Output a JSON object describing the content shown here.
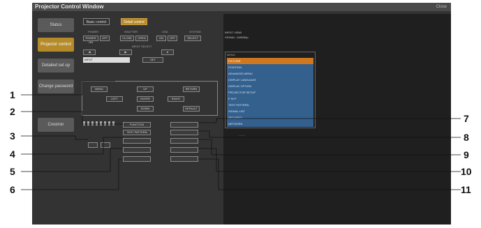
{
  "window": {
    "title": "Projector Control Window",
    "close_label": "Close"
  },
  "menu": [
    {
      "label": "Status",
      "active": false
    },
    {
      "label": "Projector control",
      "active": true
    },
    {
      "label": "Detailed set up",
      "active": false
    },
    {
      "label": "Change password",
      "active": false
    },
    {
      "label": "Crestron",
      "active": false
    }
  ],
  "tabs": [
    {
      "label": "Basic control"
    },
    {
      "label": "Detail control"
    }
  ],
  "header_labels": [
    "POWER",
    "SHUTTER",
    "OSD",
    "SYSTEM"
  ],
  "power_buttons": [
    "POWER ON",
    "OFF"
  ],
  "shutter_buttons": [
    "CLOSE",
    "OPEN"
  ],
  "osd_buttons": [
    "ON",
    "OFF"
  ],
  "system_buttons": [
    "SELECT"
  ],
  "input_label": "INPUT SELECT",
  "input_select": {
    "value": "INPUT"
  },
  "input_set_button": "SET",
  "nav": {
    "menu": "MENU",
    "up": "UP",
    "return": "RETURN",
    "left": "LEFT",
    "enter": "ENTER",
    "right": "RIGHT",
    "down": "DOWN",
    "default": "DEFAULT"
  },
  "bottom_left": [
    "FUNCTION",
    "TEST PATTERN",
    "",
    "",
    "",
    ""
  ],
  "bottom_right": [
    "",
    "",
    "",
    "",
    ""
  ],
  "right_panel": {
    "line1": "INPUT: HDMI",
    "line2": "SIGNAL: 1080/60p"
  },
  "control_list": {
    "header": "MENU",
    "items": [
      "PICTURE",
      "POSITION",
      "ADVANCED MENU",
      "DISPLAY LANGUAGE",
      "DISPLAY OPTION",
      "PROJECTOR SETUP",
      "P IN P",
      "TEST PATTERN",
      "SIGNAL LIST",
      "SECURITY",
      "NETWORK"
    ],
    "selected_index": 0
  },
  "callouts": [
    "1",
    "2",
    "3",
    "4",
    "5",
    "6",
    "7",
    "8",
    "9",
    "10",
    "11"
  ]
}
